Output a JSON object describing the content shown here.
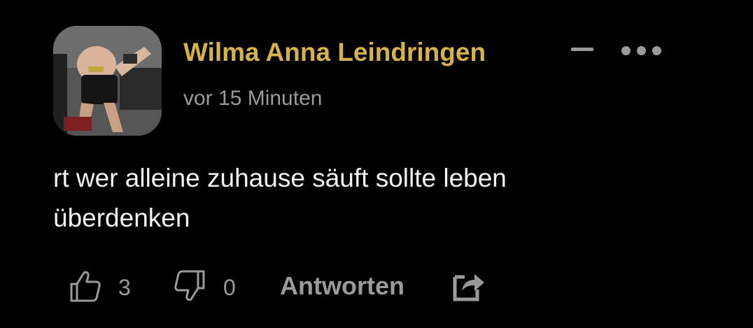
{
  "theme": {
    "background": "#000000",
    "accent": "#d6b34a",
    "muted": "#9a9a9a",
    "text": "#f2f2f2"
  },
  "comment": {
    "author": "Wilma Anna Leindringen",
    "timestamp": "vor 15 Minuten",
    "body_lines": [
      "rt wer alleine zuhause säuft sollte leben",
      "überdenken"
    ],
    "avatar": "user-avatar-photo"
  },
  "header_actions": {
    "collapse_icon": "minus-icon",
    "more_icon": "more-dots-icon"
  },
  "actions": {
    "like_icon": "thumbs-up-icon",
    "like_count": "3",
    "dislike_icon": "thumbs-down-icon",
    "dislike_count": "0",
    "reply_label": "Antworten",
    "share_icon": "share-icon"
  }
}
